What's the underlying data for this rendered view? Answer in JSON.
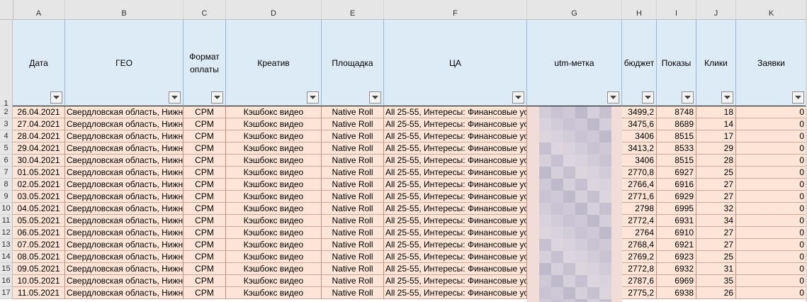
{
  "column_letters": [
    "A",
    "B",
    "C",
    "D",
    "E",
    "F",
    "G",
    "H",
    "I",
    "J",
    "K"
  ],
  "headers": {
    "date": "Дата",
    "geo": "ГЕО",
    "pay_format_line1": "Формат",
    "pay_format_line2": "оплаты",
    "creative": "Креатив",
    "platform": "Площадка",
    "audience": "ЦА",
    "utm": "utm-метка",
    "budget": "бюджет",
    "impressions": "Показы",
    "clicks": "Клики",
    "leads": "Заявки"
  },
  "row_numbers": [
    "1",
    "2",
    "3",
    "4",
    "5",
    "6",
    "7",
    "8",
    "9",
    "10",
    "11",
    "12",
    "13",
    "14",
    "15",
    "16",
    "17"
  ],
  "rows": [
    {
      "date": "26.04.2021",
      "geo": "Свердловская область, Нижн",
      "pay": "CPM",
      "creative": "Кэшбокс видео",
      "platform": "Native Roll",
      "audience": "All 25-55, Интересы: Финансовые ус",
      "budget": "3499,2",
      "impressions": "8748",
      "clicks": "18",
      "leads": "0"
    },
    {
      "date": "27.04.2021",
      "geo": "Свердловская область, Нижн",
      "pay": "CPM",
      "creative": "Кэшбокс видео",
      "platform": "Native Roll",
      "audience": "All 25-55, Интересы: Финансовые ус",
      "budget": "3475,6",
      "impressions": "8689",
      "clicks": "14",
      "leads": "0"
    },
    {
      "date": "28.04.2021",
      "geo": "Свердловская область, Нижн",
      "pay": "CPM",
      "creative": "Кэшбокс видео",
      "platform": "Native Roll",
      "audience": "All 25-55, Интересы: Финансовые ус",
      "budget": "3406",
      "impressions": "8515",
      "clicks": "17",
      "leads": "0"
    },
    {
      "date": "29.04.2021",
      "geo": "Свердловская область, Нижн",
      "pay": "CPM",
      "creative": "Кэшбокс видео",
      "platform": "Native Roll",
      "audience": "All 25-55, Интересы: Финансовые ус",
      "budget": "3413,2",
      "impressions": "8533",
      "clicks": "29",
      "leads": "0"
    },
    {
      "date": "30.04.2021",
      "geo": "Свердловская область, Нижн",
      "pay": "CPM",
      "creative": "Кэшбокс видео",
      "platform": "Native Roll",
      "audience": "All 25-55, Интересы: Финансовые ус",
      "budget": "3406",
      "impressions": "8515",
      "clicks": "28",
      "leads": "0"
    },
    {
      "date": "01.05.2021",
      "geo": "Свердловская область, Нижн",
      "pay": "CPM",
      "creative": "Кэшбокс видео",
      "platform": "Native Roll",
      "audience": "All 25-55, Интересы: Финансовые ус",
      "budget": "2770,8",
      "impressions": "6927",
      "clicks": "25",
      "leads": "0"
    },
    {
      "date": "02.05.2021",
      "geo": "Свердловская область, Нижн",
      "pay": "CPM",
      "creative": "Кэшбокс видео",
      "platform": "Native Roll",
      "audience": "All 25-55, Интересы: Финансовые ус",
      "budget": "2766,4",
      "impressions": "6916",
      "clicks": "27",
      "leads": "0"
    },
    {
      "date": "03.05.2021",
      "geo": "Свердловская область, Нижн",
      "pay": "CPM",
      "creative": "Кэшбокс видео",
      "platform": "Native Roll",
      "audience": "All 25-55, Интересы: Финансовые ус",
      "budget": "2771,6",
      "impressions": "6929",
      "clicks": "27",
      "leads": "0"
    },
    {
      "date": "04.05.2021",
      "geo": "Свердловская область, Нижн",
      "pay": "CPM",
      "creative": "Кэшбокс видео",
      "platform": "Native Roll",
      "audience": "All 25-55, Интересы: Финансовые ус",
      "budget": "2798",
      "impressions": "6995",
      "clicks": "32",
      "leads": "0"
    },
    {
      "date": "05.05.2021",
      "geo": "Свердловская область, Нижн",
      "pay": "CPM",
      "creative": "Кэшбокс видео",
      "platform": "Native Roll",
      "audience": "All 25-55, Интересы: Финансовые ус",
      "budget": "2772,4",
      "impressions": "6931",
      "clicks": "34",
      "leads": "0"
    },
    {
      "date": "06.05.2021",
      "geo": "Свердловская область, Нижн",
      "pay": "CPM",
      "creative": "Кэшбокс видео",
      "platform": "Native Roll",
      "audience": "All 25-55, Интересы: Финансовые ус",
      "budget": "2764",
      "impressions": "6910",
      "clicks": "27",
      "leads": "0"
    },
    {
      "date": "07.05.2021",
      "geo": "Свердловская область, Нижн",
      "pay": "CPM",
      "creative": "Кэшбокс видео",
      "platform": "Native Roll",
      "audience": "All 25-55, Интересы: Финансовые ус",
      "budget": "2768,4",
      "impressions": "6921",
      "clicks": "27",
      "leads": "0"
    },
    {
      "date": "08.05.2021",
      "geo": "Свердловская область, Нижн",
      "pay": "CPM",
      "creative": "Кэшбокс видео",
      "platform": "Native Roll",
      "audience": "All 25-55, Интересы: Финансовые ус",
      "budget": "2769,2",
      "impressions": "6923",
      "clicks": "25",
      "leads": "0"
    },
    {
      "date": "09.05.2021",
      "geo": "Свердловская область, Нижн",
      "pay": "CPM",
      "creative": "Кэшбокс видео",
      "platform": "Native Roll",
      "audience": "All 25-55, Интересы: Финансовые ус",
      "budget": "2772,8",
      "impressions": "6932",
      "clicks": "31",
      "leads": "0"
    },
    {
      "date": "10.05.2021",
      "geo": "Свердловская область, Нижн",
      "pay": "CPM",
      "creative": "Кэшбокс видео",
      "platform": "Native Roll",
      "audience": "All 25-55, Интересы: Финансовые ус",
      "budget": "2787,6",
      "impressions": "6969",
      "clicks": "35",
      "leads": "0"
    },
    {
      "date": "11.05.2021",
      "geo": "Свердловская область, Нижн",
      "pay": "CPM",
      "creative": "Кэшбокс видео",
      "platform": "Native Roll",
      "audience": "All 25-55, Интересы: Финансовые ус",
      "budget": "2775,2",
      "impressions": "6938",
      "clicks": "26",
      "leads": "0"
    }
  ],
  "colors": {
    "header_fill": "#ddebf7",
    "data_fill": "#fce4d6",
    "gridline_header": "#e6e6e6",
    "selection_green": "#217346"
  },
  "icons": {
    "filter": "filter-dropdown-icon"
  }
}
